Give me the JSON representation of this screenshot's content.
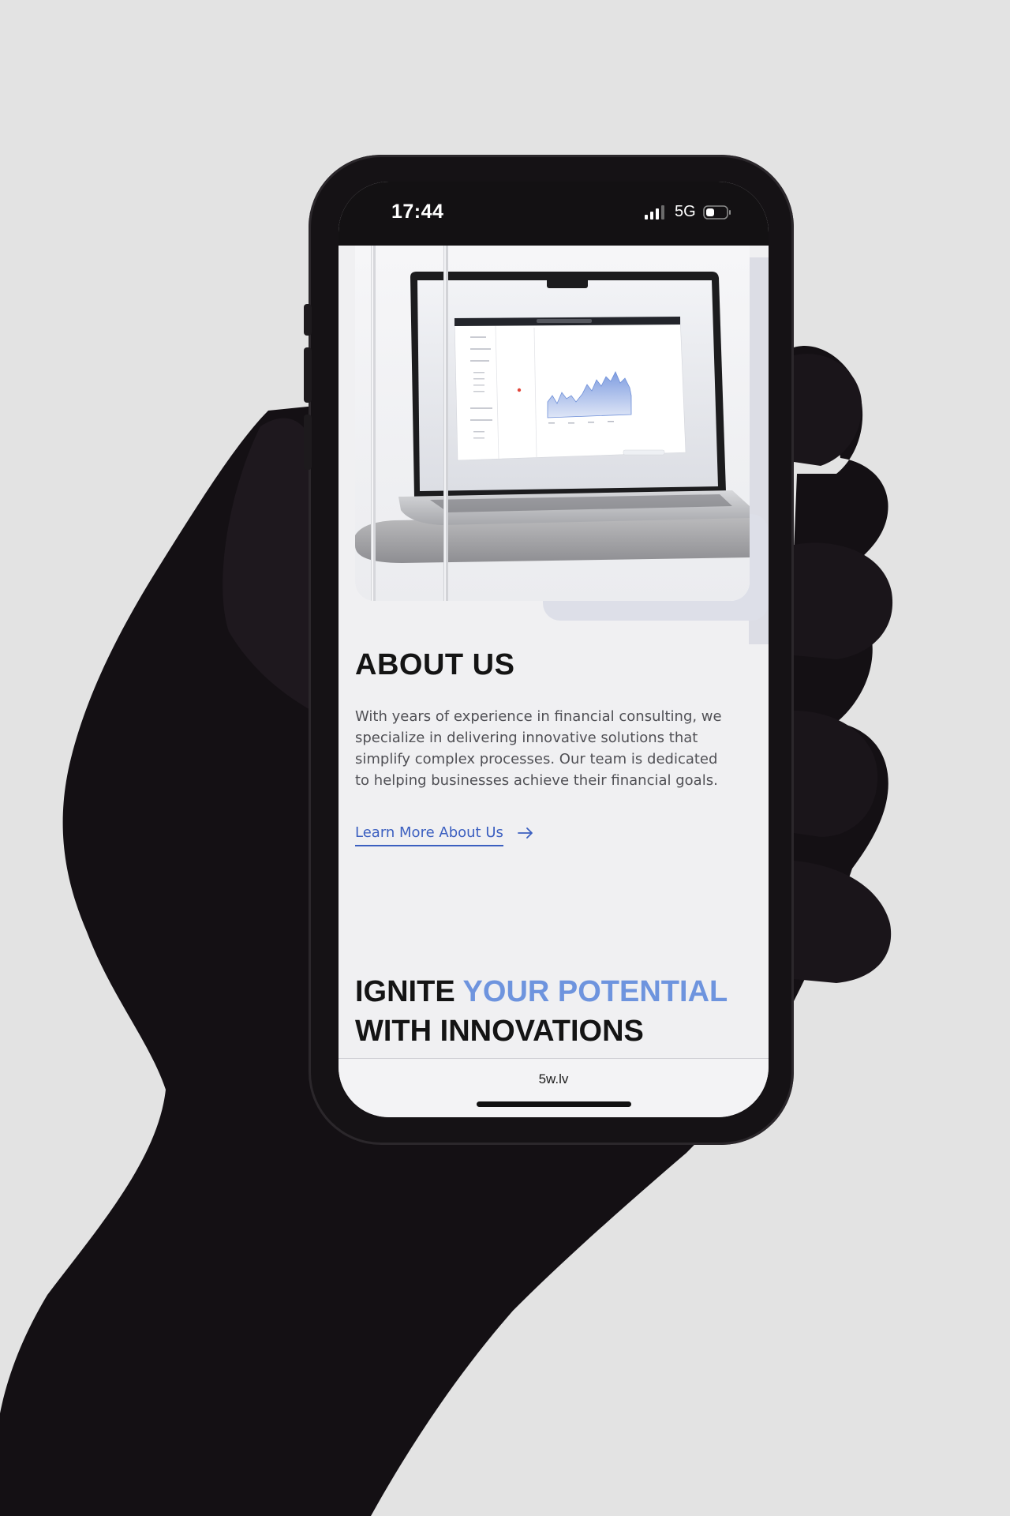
{
  "status_bar": {
    "time": "17:44",
    "network": "5G",
    "icons": [
      "signal-bars-icon",
      "battery-icon"
    ]
  },
  "about": {
    "title": "ABOUT US",
    "body": "With years of experience in financial consulting, we specialize in delivering innovative solutions that simplify complex processes. Our team is dedicated to helping businesses achieve their financial goals.",
    "link_label": "Learn More About Us",
    "link_icon": "arrow-right-icon"
  },
  "ignite": {
    "part1": "IGNITE ",
    "part2": "YOUR POTENTIAL",
    "part3": "WITH INNOVATIONS"
  },
  "browser": {
    "url": "5w.lv"
  },
  "colors": {
    "accent": "#6e94de",
    "link": "#3b5fc0",
    "text": "#141414",
    "screen_bg": "#f0f0f2"
  }
}
